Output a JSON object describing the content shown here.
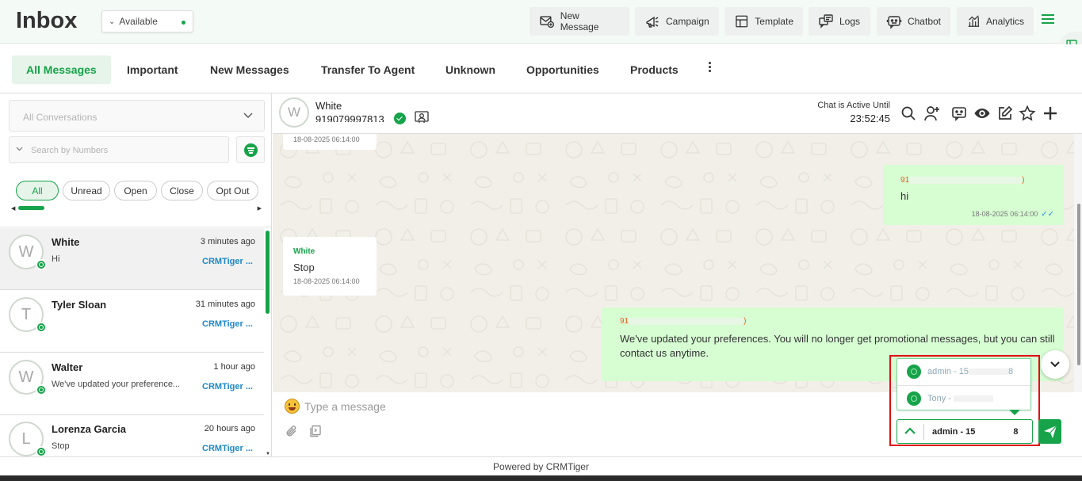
{
  "header": {
    "title": "Inbox",
    "status": "Available",
    "buttons": [
      {
        "label": "New Message",
        "icon": "new-message-icon"
      },
      {
        "label": "Campaign",
        "icon": "megaphone-icon"
      },
      {
        "label": "Template",
        "icon": "template-icon"
      },
      {
        "label": "Logs",
        "icon": "logs-icon"
      },
      {
        "label": "Chatbot",
        "icon": "chatbot-icon"
      },
      {
        "label": "Analytics",
        "icon": "analytics-icon"
      }
    ]
  },
  "tabs": [
    "All Messages",
    "Important",
    "New Messages",
    "Transfer To Agent",
    "Unknown",
    "Opportunities",
    "Products"
  ],
  "sidebar": {
    "conversation_filter": "All Conversations",
    "search_placeholder": "Search by Numbers",
    "pills": [
      "All",
      "Unread",
      "Open",
      "Close",
      "Opt Out"
    ],
    "conversations": [
      {
        "initial": "W",
        "name": "White",
        "time": "3 minutes ago",
        "preview": "Hi",
        "owner": "CRMTiger ..."
      },
      {
        "initial": "T",
        "name": "Tyler Sloan",
        "time": "31 minutes ago",
        "preview": "",
        "owner": "CRMTiger ..."
      },
      {
        "initial": "W",
        "name": "Walter",
        "time": "1 hour ago",
        "preview": "We've updated your preference...",
        "owner": "CRMTiger ..."
      },
      {
        "initial": "L",
        "name": "Lorenza Garcia",
        "time": "20 hours ago",
        "preview": "Stop",
        "owner": "CRMTiger ..."
      }
    ]
  },
  "chat": {
    "contact_initial": "W",
    "contact_name": "White",
    "contact_number": "919079997813",
    "active_label": "Chat is Active Until",
    "active_time": "23:52:45",
    "messages": [
      {
        "dir": "in",
        "sender": "",
        "text": "",
        "time": "18-08-2025 06:14:00"
      },
      {
        "dir": "out",
        "sender_prefix": "91",
        "sender_suffix": ")",
        "text": "hi",
        "time": "18-08-2025 06:14:00"
      },
      {
        "dir": "in",
        "sender": "White",
        "text": "Stop",
        "time": "18-08-2025 06:14:00"
      },
      {
        "dir": "out",
        "sender_prefix": "91",
        "sender_suffix": ")",
        "text": "We've updated your preferences. You will no longer get promotional messages, but you can still contact us anytime.",
        "time": ""
      }
    ],
    "composer_placeholder": "Type a message",
    "sender_options": [
      {
        "prefix": "admin - 15",
        "suffix": "8"
      },
      {
        "prefix": "Tony - ",
        "suffix": ""
      }
    ],
    "selected_sender_prefix": "admin - 15",
    "selected_sender_suffix": "8"
  },
  "footer": "Powered by CRMTiger",
  "colors": {
    "accent": "#16a34a",
    "link": "#1e88c8",
    "outgoing": "#d7fdd3"
  }
}
